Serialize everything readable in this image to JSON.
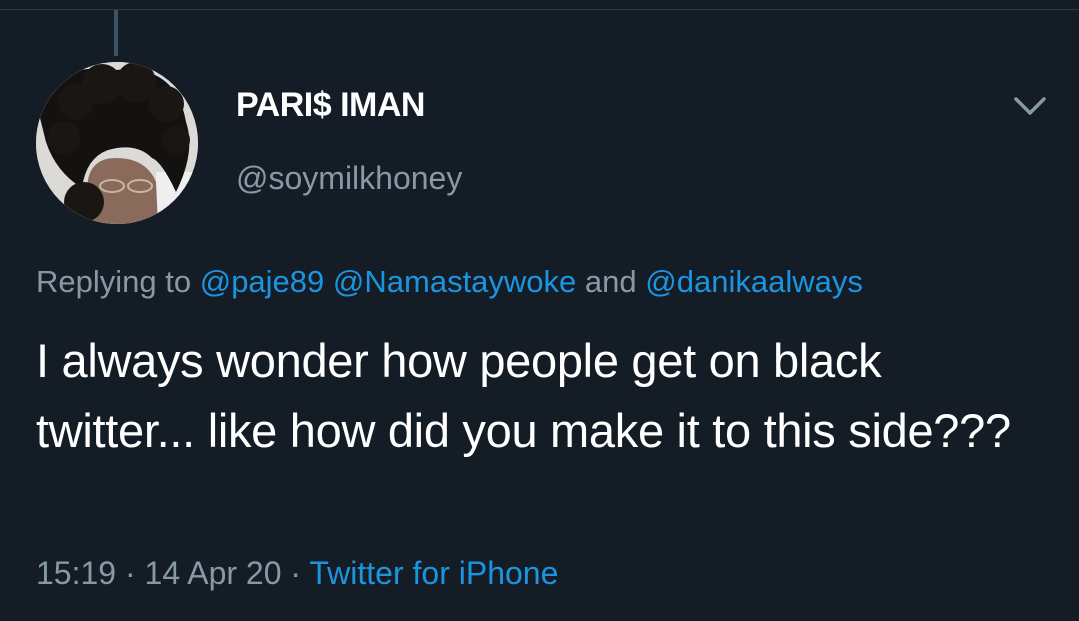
{
  "tweet": {
    "display_name": "PARI$ IMAN",
    "handle": "@soymilkhoney",
    "replying_prefix": "Replying to",
    "replying_mentions": [
      "@paje89",
      "@Namastaywoke"
    ],
    "replying_and": "and",
    "replying_last": "@danikaalways",
    "text": "I always wonder how people get on black twitter... like how did you make it to this side???",
    "time": "15:19",
    "separator": "·",
    "date": "14 Apr 20",
    "source": "Twitter for iPhone"
  },
  "icons": {
    "more": "chevron-down-icon",
    "avatar": "avatar"
  },
  "colors": {
    "background": "#141d26",
    "primary_text": "#ffffff",
    "secondary_text": "#8899a6",
    "link": "#1b95e0",
    "thread_line": "#3d5466"
  }
}
